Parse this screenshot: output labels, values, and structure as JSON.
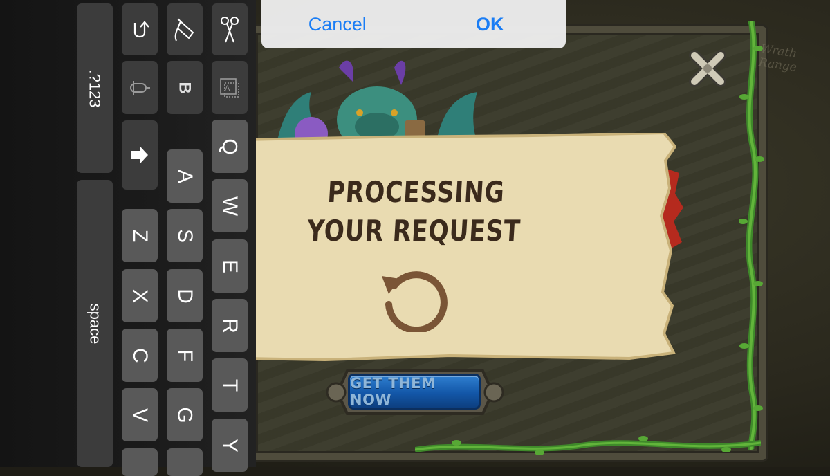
{
  "alert": {
    "cancel_label": "Cancel",
    "ok_label": "OK"
  },
  "game": {
    "map_label": "Wrath Range",
    "processing_title": "PROCESSING YOUR REQUEST",
    "get_button_label": "GET THEM NOW",
    "icons": [
      "close-x-icon",
      "spinner-refresh-icon",
      "dragon-art"
    ]
  },
  "keyboard": {
    "numbers_key": ".?123",
    "space_key": "space",
    "function_icons": [
      "undo-icon",
      "paste-icon",
      "cut-icon",
      "dictation-icon",
      "bold-icon",
      "text-format-icon",
      "shift-icon"
    ],
    "bold_key": "B",
    "row_q": [
      "Q",
      "W",
      "E",
      "R",
      "T",
      "Y"
    ],
    "row_a": [
      "A",
      "S",
      "D",
      "F",
      "G"
    ],
    "row_z": [
      "Z",
      "X",
      "C",
      "V"
    ]
  },
  "colors": {
    "ios_blue": "#1a7df5",
    "key_light": "#595959",
    "key_dark": "#3c3c3c",
    "parchment": "#ebdcaf",
    "game_button_blue": "#1357a8"
  }
}
